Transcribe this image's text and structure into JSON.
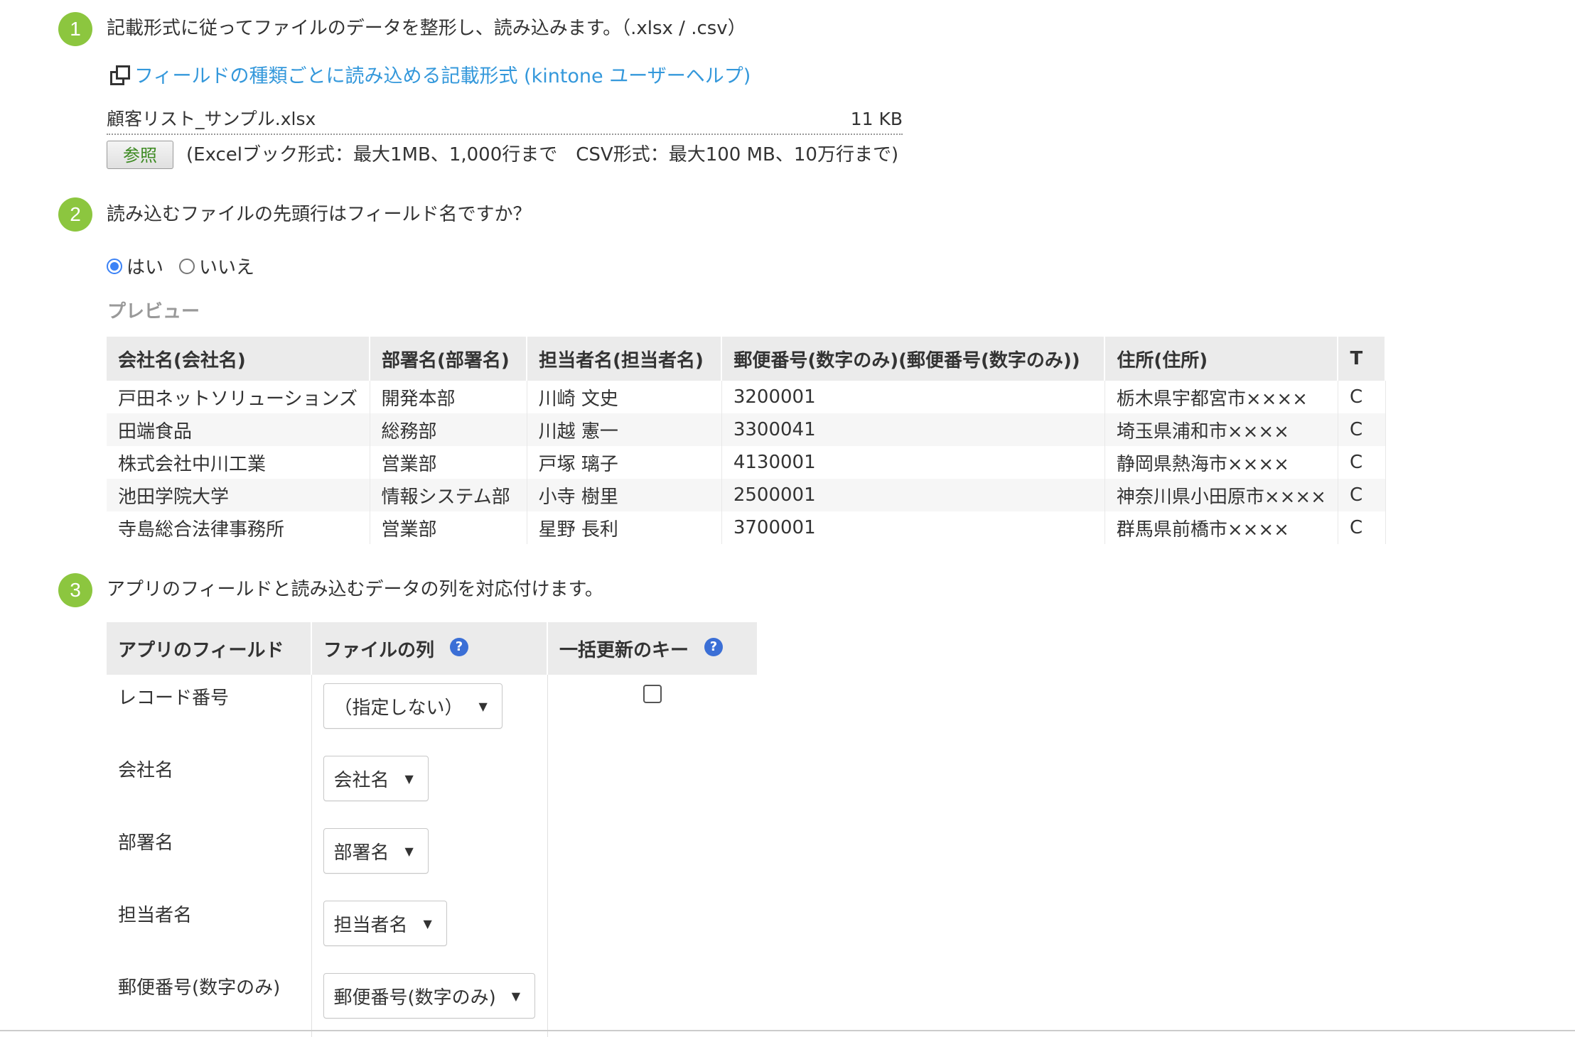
{
  "step1": {
    "number": "1",
    "title": "記載形式に従ってファイルのデータを整形し、読み込みます。（.xlsx / .csv）",
    "link_text": "フィールドの種類ごとに読み込める記載形式 (kintone ユーザーヘルプ)",
    "file_name": "顧客リスト_サンプル.xlsx",
    "file_size": "11 KB",
    "browse_label": "参照",
    "limits_text": "(Excelブック形式：最大1MB、1,000行まで　CSV形式：最大100 MB、10万行まで)"
  },
  "step2": {
    "number": "2",
    "title": "読み込むファイルの先頭行はフィールド名ですか？",
    "options": [
      {
        "label": "はい",
        "checked": true
      },
      {
        "label": "いいえ",
        "checked": false
      }
    ],
    "preview_label": "プレビュー",
    "preview": {
      "headers": [
        "会社名(会社名)",
        "部署名(部署名)",
        "担当者名(担当者名)",
        "郵便番号(数字のみ)(郵便番号(数字のみ))",
        "住所(住所)",
        "T"
      ],
      "rows": [
        [
          "戸田ネットソリューションズ",
          "開発本部",
          "川崎 文史",
          "3200001",
          "栃木県宇都宮市××××",
          "C"
        ],
        [
          "田端食品",
          "総務部",
          "川越 憲一",
          "3300041",
          "埼玉県浦和市××××",
          "C"
        ],
        [
          "株式会社中川工業",
          "営業部",
          "戸塚 璃子",
          "4130001",
          "静岡県熱海市××××",
          "C"
        ],
        [
          "池田学院大学",
          "情報システム部",
          "小寺 樹里",
          "2500001",
          "神奈川県小田原市××××",
          "C"
        ],
        [
          "寺島総合法律事務所",
          "営業部",
          "星野 長利",
          "3700001",
          "群馬県前橋市××××",
          "C"
        ]
      ]
    }
  },
  "step3": {
    "number": "3",
    "title": "アプリのフィールドと読み込むデータの列を対応付けます。",
    "headers": {
      "field": "アプリのフィールド",
      "column": "ファイルの列",
      "key": "一括更新のキー"
    },
    "help_icon": "?",
    "rows": [
      {
        "field": "レコード番号",
        "select": "（指定しない）",
        "has_key": true
      },
      {
        "field": "会社名",
        "select": "会社名",
        "has_key": false
      },
      {
        "field": "部署名",
        "select": "部署名",
        "has_key": false
      },
      {
        "field": "担当者名",
        "select": "担当者名",
        "has_key": false
      },
      {
        "field": "郵便番号(数字のみ)",
        "select": "郵便番号(数字のみ)",
        "has_key": false
      }
    ]
  },
  "colors": {
    "badge": "#8cc63f",
    "link": "#3498db",
    "radio": "#3b82f6",
    "help": "#3b6fd6",
    "browse_text": "#3d8a22"
  },
  "icons": {
    "link": "external-window-icon",
    "help": "question-help-icon",
    "dropdown": "caret-down-icon"
  }
}
